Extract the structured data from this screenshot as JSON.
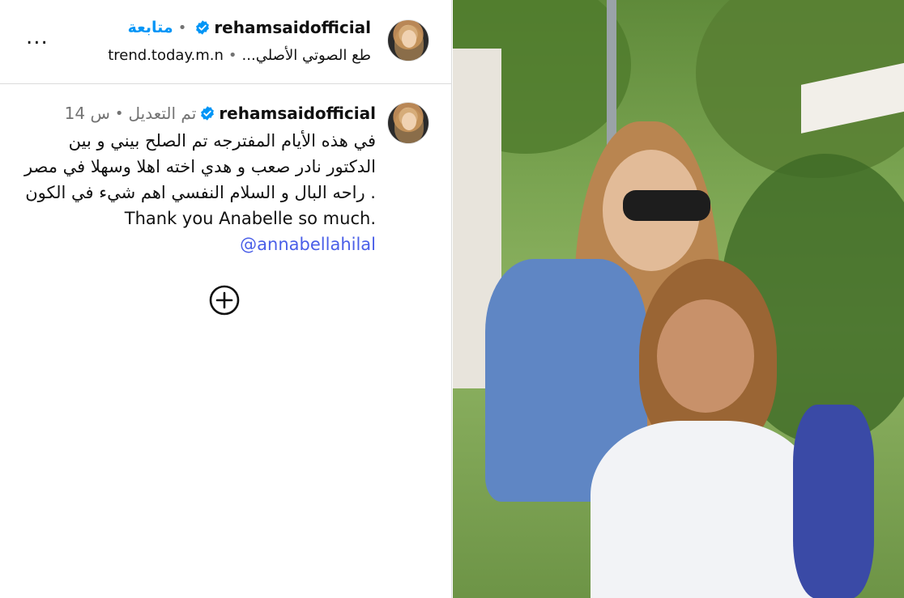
{
  "header": {
    "username": "rehamsaidofficial",
    "separator": "•",
    "follow_label": "متابعة",
    "audio_label": "...طع الصوتي الأصلي",
    "audio_source": "trend.today.m.n",
    "more_label": "..."
  },
  "post": {
    "username": "rehamsaidofficial",
    "edited_label": "تم التعديل",
    "time": "14 س",
    "separator": "•",
    "caption_text": "في هذه الأيام المفترجه تم الصلح بيني و بين الدكتور نادر صعب و هدي اخته اهلا وسهلا في مصر . راحه البال و السلام النفسي اهم شيء في الكون .Thank you Anabelle so much ",
    "mention": "@annabellahilal"
  },
  "icons": {
    "verified": "verified-badge-icon",
    "add": "add-circle-icon",
    "more": "more-options-icon"
  },
  "colors": {
    "link_blue": "#0095f6",
    "verified_blue": "#0095f6",
    "mention_blue": "#4a5fe8",
    "secondary_text": "#737373",
    "divider": "#dbdbdb"
  }
}
